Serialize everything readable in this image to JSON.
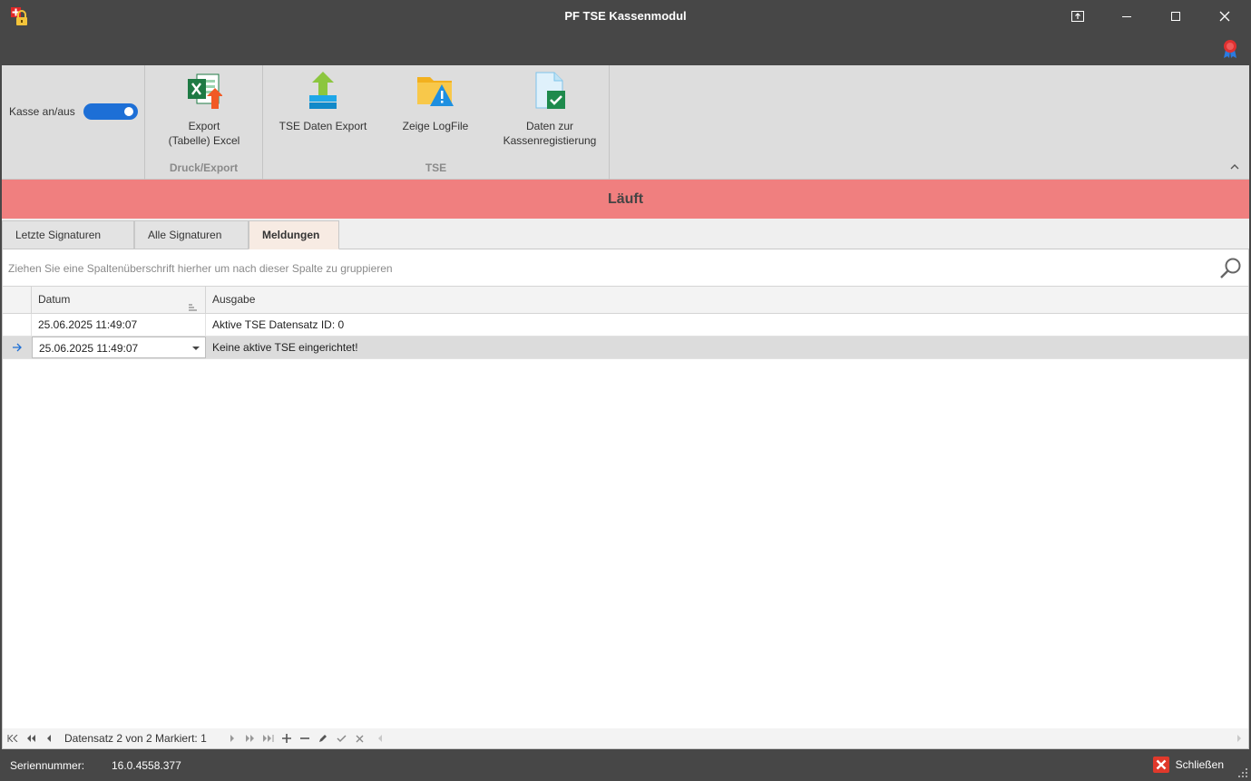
{
  "window": {
    "title": "PF TSE Kassenmodul"
  },
  "ribbon": {
    "toggle_label": "Kasse an/aus",
    "toggle_on": true,
    "groups": [
      {
        "caption": "Druck/Export",
        "buttons": [
          {
            "label": "Export\n(Tabelle) Excel",
            "icon": "excel-export-icon"
          }
        ]
      },
      {
        "caption": "TSE",
        "buttons": [
          {
            "label": "TSE Daten Export",
            "icon": "upload-arrow-icon"
          },
          {
            "label": "Zeige LogFile",
            "icon": "folder-warning-icon"
          },
          {
            "label": "Daten zur\nKassenregistierung",
            "icon": "document-check-icon"
          }
        ]
      }
    ]
  },
  "status_band": {
    "text": "Läuft",
    "color": "#f07f7f"
  },
  "tabs": [
    {
      "label": "Letzte Signaturen",
      "active": false
    },
    {
      "label": "Alle Signaturen",
      "active": false
    },
    {
      "label": "Meldungen",
      "active": true
    }
  ],
  "grid": {
    "group_panel_hint": "Ziehen Sie eine Spaltenüberschrift hierher um nach dieser Spalte zu gruppieren",
    "columns": [
      "Datum",
      "Ausgabe"
    ],
    "rows": [
      {
        "datum": "25.06.2025 11:49:07",
        "ausgabe": "Aktive TSE Datensatz ID: 0",
        "focused": false
      },
      {
        "datum": "25.06.2025 11:49:07",
        "ausgabe": "Keine aktive TSE eingerichtet!",
        "focused": true
      }
    ],
    "navigator_text": "Datensatz 2 von 2 Markiert: 1"
  },
  "statusbar": {
    "serial_label": "Seriennummer:",
    "serial_value": "16.0.4558.377",
    "close_label": "Schließen"
  },
  "colors": {
    "titlebar": "#474747",
    "ribbon": "#dddddd",
    "accent": "#1d6fd6",
    "active_tab": "#f7ebe3"
  }
}
